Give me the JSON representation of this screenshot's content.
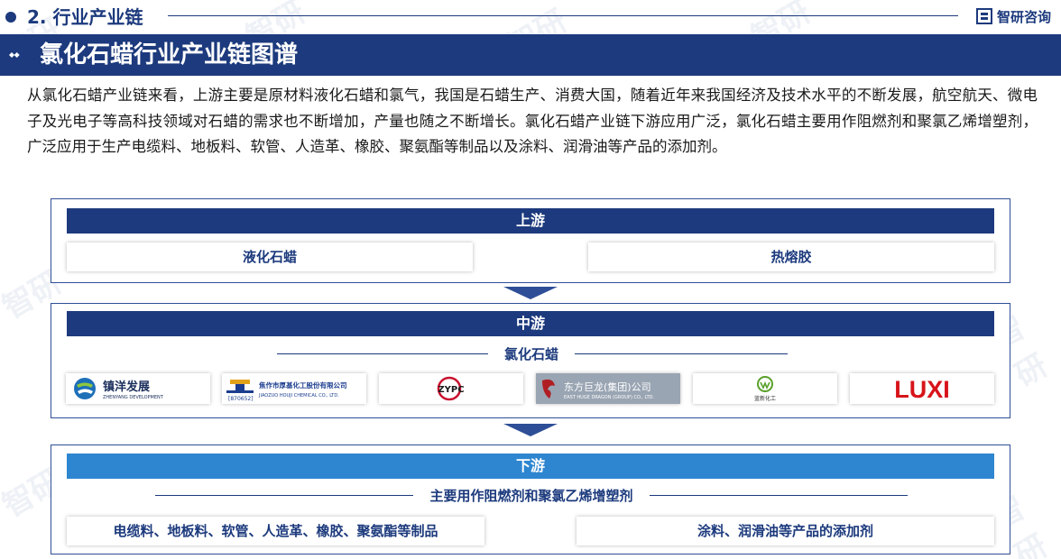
{
  "header": {
    "section_title": "2. 行业产业链",
    "brand_name": "智研咨询"
  },
  "banner": {
    "title": "氯化石蜡行业产业链图谱"
  },
  "intro": "从氯化石蜡产业链来看，上游主要是原材料液化石蜡和氯气，我国是石蜡生产、消费大国，随着近年来我国经济及技术水平的不断发展，航空航天、微电子及光电子等高科技领域对石蜡的需求也不断增加，产量也随之不断增长。氯化石蜡产业链下游应用广泛，氯化石蜡主要用作阻燃剂和聚氯乙烯增塑剂，广泛应用于生产电缆料、地板料、软管、人造革、橡胶、聚氨酯等制品以及涂料、润滑油等产品的添加剂。",
  "upstream": {
    "label": "上游",
    "items": [
      "液化石蜡",
      "热熔胶"
    ]
  },
  "midstream": {
    "label": "中游",
    "product": "氯化石蜡",
    "companies": [
      {
        "name": "镇洋发展",
        "sub": "ZHENYANG DEVELOPMENT",
        "icon": "zhenyang-logo-icon",
        "color": "#1d6fb8"
      },
      {
        "name": "焦作市厚基化工股份有限公司",
        "sub": "JIAOZUO HOUJI CHEMICAL CO., LTD.",
        "code": "[870652]",
        "icon": "houji-logo-icon",
        "color": "#1b3d8f"
      },
      {
        "name": "ZYPC",
        "icon": "zypc-logo-icon",
        "color": "#c8102e"
      },
      {
        "name": "东方巨龙(集团)公司",
        "sub": "EAST HUGE DRAGON (GROUP) CO., LTD.",
        "icon": "east-huge-dragon-logo-icon",
        "color": "#b01e23"
      },
      {
        "name": "蓝新化工",
        "icon": "lanxin-logo-icon",
        "color": "#5aa02c"
      },
      {
        "name": "LUXI",
        "icon": "luxi-logo-icon",
        "color": "#d7141a"
      }
    ]
  },
  "downstream": {
    "label": "下游",
    "usage": "主要用作阻燃剂和聚氯乙烯增塑剂",
    "items": [
      "电缆料、地板料、软管、人造革、橡胶、聚氨酯等制品",
      "涂料、润滑油等产品的添加剂"
    ]
  },
  "colors": {
    "navy": "#1c3a7d",
    "blue": "#2e86d0"
  }
}
